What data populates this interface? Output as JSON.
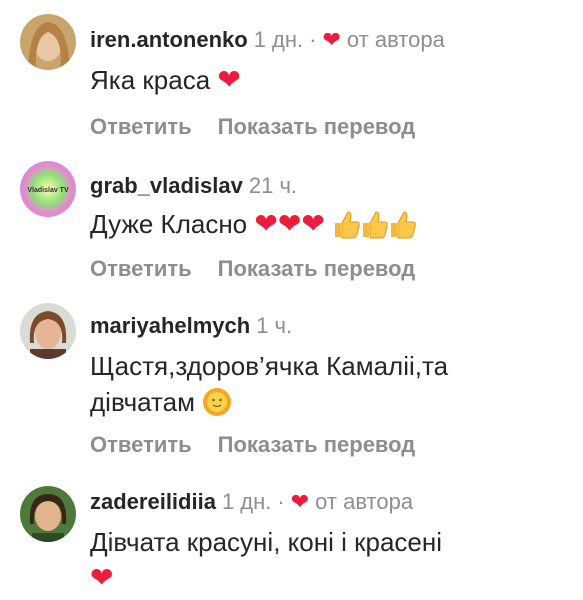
{
  "comments": [
    {
      "username": "iren.antonenko",
      "time": "1 дн.",
      "dot": "·",
      "by_author": "от автора",
      "text": "Яка краса",
      "reply": "Ответить",
      "translate": "Показать перевод"
    },
    {
      "username": "grab_vladislav",
      "time": "21 ч.",
      "avatar_text": "Vladislav TV",
      "text": "Дуже Класно",
      "reply": "Ответить",
      "translate": "Показать перевод"
    },
    {
      "username": "mariyahelmych",
      "time": "1 ч.",
      "text_line1": "Щастя,здоров’ячка Камаліі,та",
      "text_line2": "дівчатам",
      "reply": "Ответить",
      "translate": "Показать перевод"
    },
    {
      "username": "zadereilidiia",
      "time": "1 дн.",
      "dot": "·",
      "by_author": "от автора",
      "text": "Дівчата красуні, коні і красені"
    }
  ],
  "colors": {
    "heart": "#ed1c3a",
    "muted": "#8e8e8e",
    "text": "#262626"
  },
  "icons": [
    "heart-icon",
    "thumbs-up-icon",
    "sun-face-icon"
  ]
}
